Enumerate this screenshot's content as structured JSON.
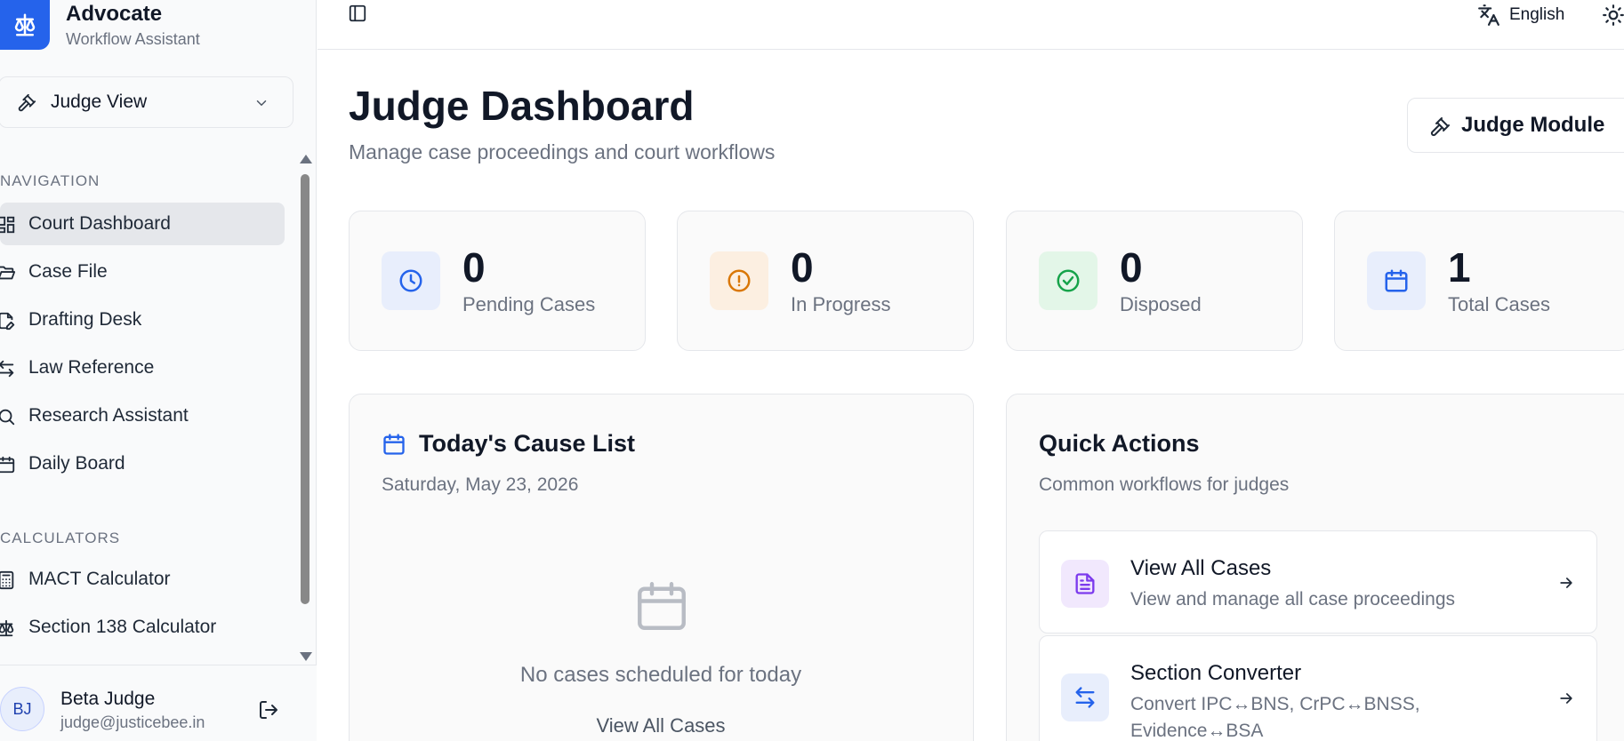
{
  "brand": {
    "title": "Advocate",
    "subtitle": "Workflow Assistant"
  },
  "view_selector": {
    "label": "Judge View"
  },
  "nav": {
    "section_navigation": "NAVIGATION",
    "items": [
      {
        "label": "Court Dashboard",
        "icon": "dashboard-grid-icon",
        "active": true
      },
      {
        "label": "Case File",
        "icon": "folder-open-icon"
      },
      {
        "label": "Drafting Desk",
        "icon": "file-pen-icon"
      },
      {
        "label": "Law Reference",
        "icon": "arrows-exchange-icon"
      },
      {
        "label": "Research Assistant",
        "icon": "search-icon"
      },
      {
        "label": "Daily Board",
        "icon": "calendar-icon"
      }
    ],
    "section_calculators": "CALCULATORS",
    "calculators": [
      {
        "label": "MACT Calculator",
        "icon": "calculator-icon"
      },
      {
        "label": "Section 138 Calculator",
        "icon": "scale-icon"
      }
    ]
  },
  "user": {
    "initials": "BJ",
    "name": "Beta Judge",
    "email": "judge@justicebee.in"
  },
  "topbar": {
    "language": "English"
  },
  "header": {
    "title": "Judge Dashboard",
    "subtitle": "Manage case proceedings and court workflows",
    "module_button": "Judge Module"
  },
  "stats": [
    {
      "value": "0",
      "label": "Pending Cases",
      "icon": "clock-icon",
      "color": "#2563eb",
      "bg": "#e8eefc"
    },
    {
      "value": "0",
      "label": "In Progress",
      "icon": "alert-circle-icon",
      "color": "#d97706",
      "bg": "#fcefe1"
    },
    {
      "value": "0",
      "label": "Disposed",
      "icon": "check-circle-icon",
      "color": "#16a34a",
      "bg": "#e3f6e8"
    },
    {
      "value": "1",
      "label": "Total Cases",
      "icon": "calendar-icon",
      "color": "#2563eb",
      "bg": "#e8eefc"
    }
  ],
  "cause_list": {
    "title": "Today's Cause List",
    "date": "Saturday, May 23, 2026",
    "empty_text": "No cases scheduled for today",
    "view_all": "View All Cases"
  },
  "quick_actions": {
    "title": "Quick Actions",
    "subtitle": "Common workflows for judges",
    "items": [
      {
        "title": "View All Cases",
        "desc": "View and manage all case proceedings",
        "icon": "file-text-icon",
        "color": "#7c3aed",
        "bg": "#f1e8fd"
      },
      {
        "title": "Section Converter",
        "desc": "Convert IPC↔BNS, CrPC↔BNSS, Evidence↔BSA",
        "icon": "arrows-exchange-icon",
        "color": "#2563eb",
        "bg": "#e8eefc"
      }
    ]
  }
}
